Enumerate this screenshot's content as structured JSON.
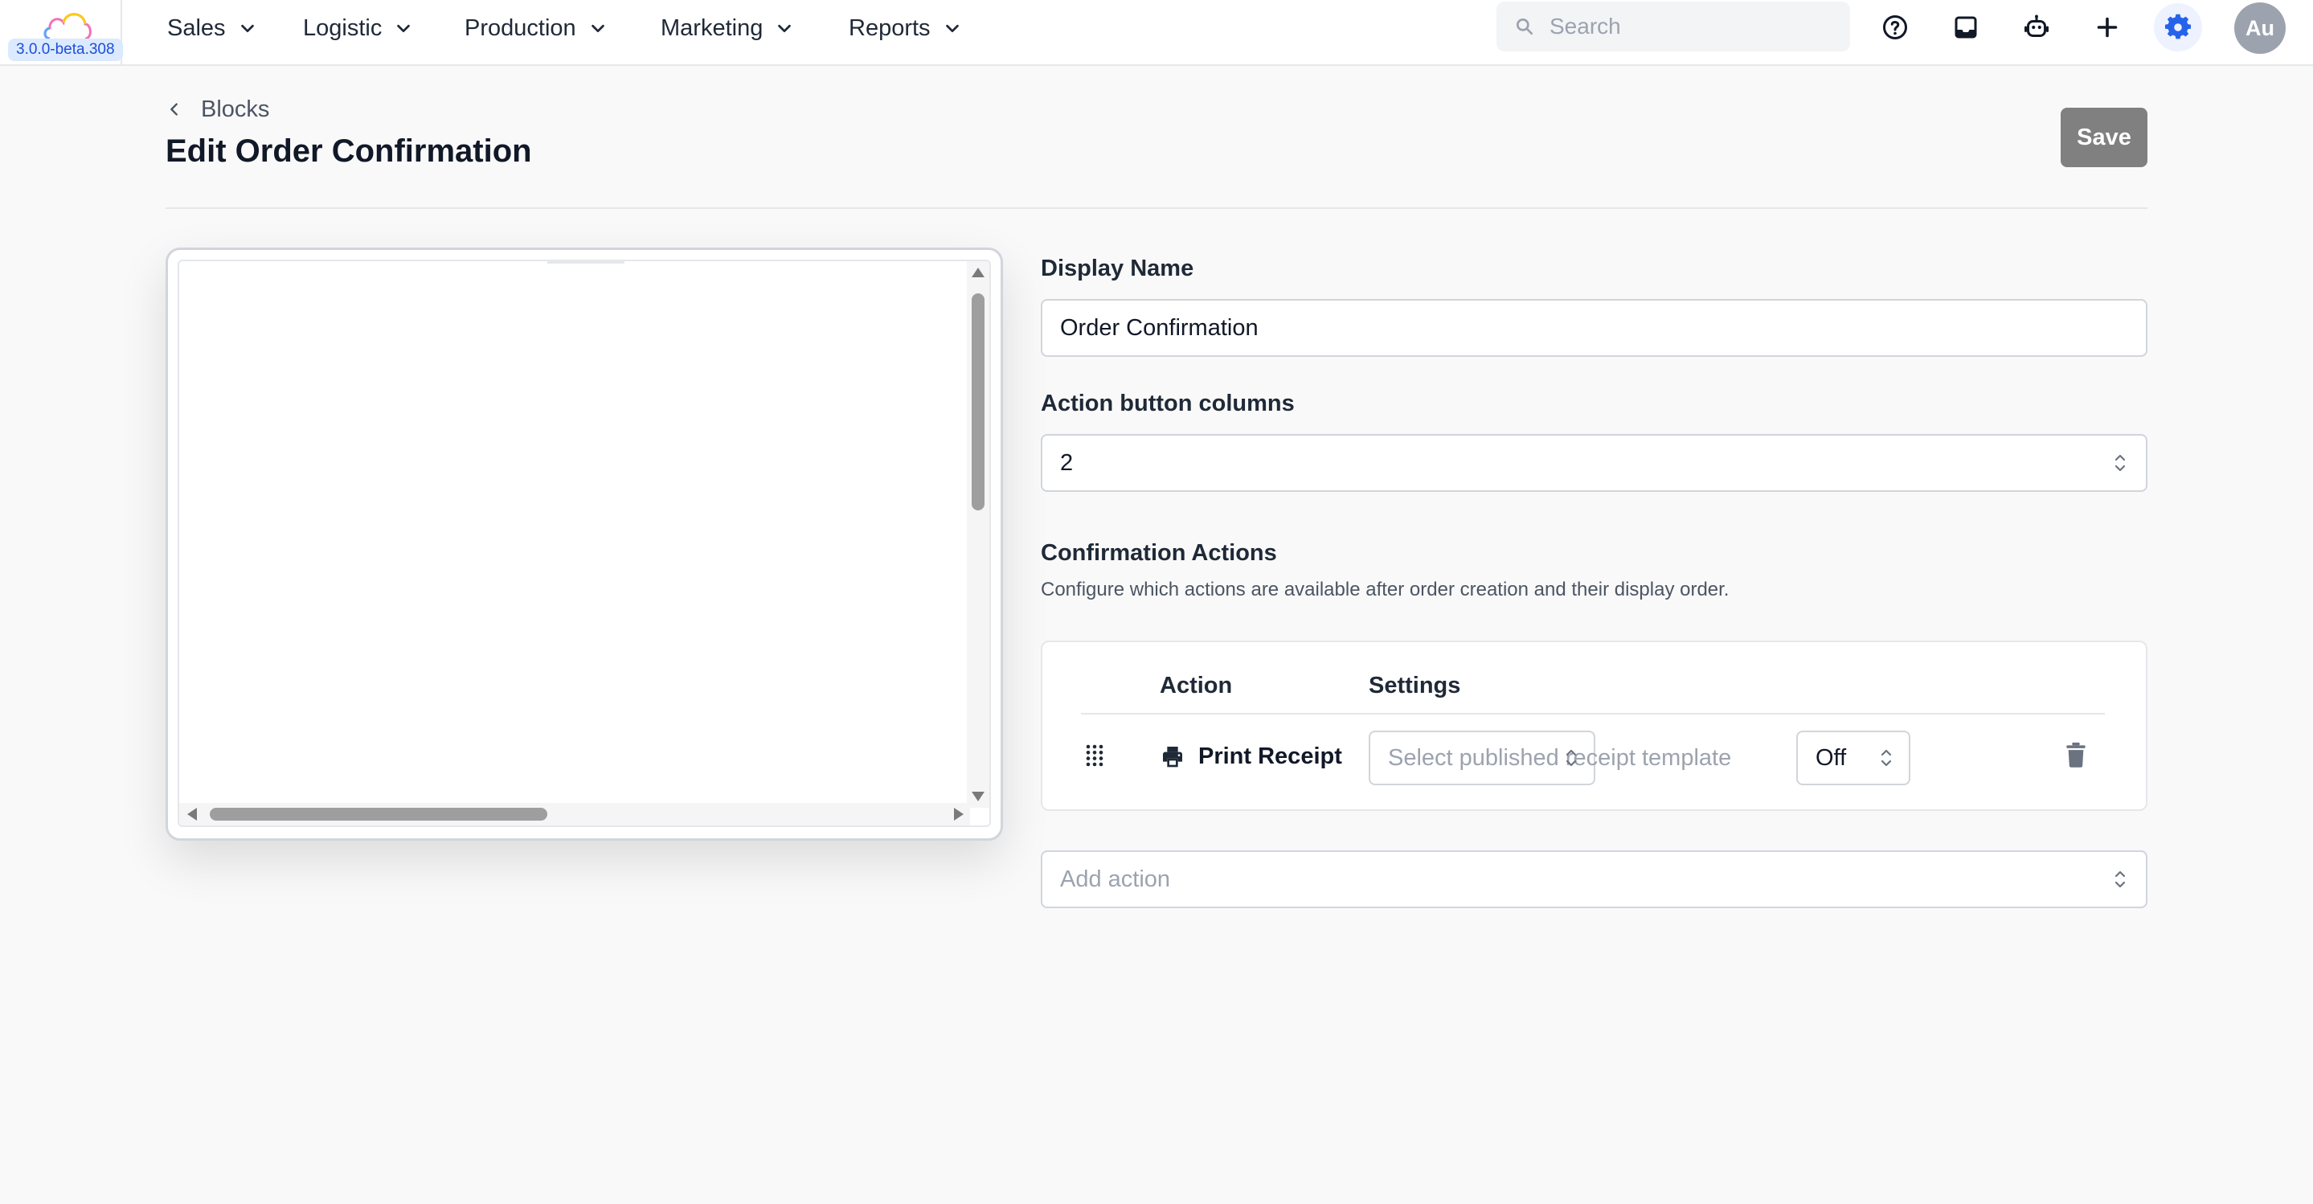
{
  "app": {
    "version": "3.0.0-beta.308",
    "brand_colors": [
      "#60a5fa",
      "#f472b6",
      "#facc15"
    ]
  },
  "nav": {
    "items": [
      {
        "label": "Sales"
      },
      {
        "label": "Logistic"
      },
      {
        "label": "Production"
      },
      {
        "label": "Marketing"
      },
      {
        "label": "Reports"
      }
    ]
  },
  "search": {
    "placeholder": "Search",
    "value": ""
  },
  "toolbar": {
    "icons": [
      "help-circle-icon",
      "inbox-icon",
      "robot-icon",
      "plus-icon",
      "gear-icon"
    ],
    "active_icon_color": "#2563eb"
  },
  "user": {
    "initials": "Au"
  },
  "page": {
    "breadcrumb": "Blocks",
    "title": "Edit Order Confirmation",
    "save_label": "Save"
  },
  "form": {
    "display_name": {
      "label": "Display Name",
      "value": "Order Confirmation"
    },
    "action_button_columns": {
      "label": "Action button columns",
      "value": "2"
    },
    "confirmation_actions": {
      "title": "Confirmation Actions",
      "description": "Configure which actions are available after order creation and their display order.",
      "columns": {
        "action": "Action",
        "settings": "Settings"
      },
      "rows": [
        {
          "icon": "printer-icon",
          "label": "Print Receipt",
          "template_placeholder": "Select published receipt template",
          "toggle_value": "Off"
        }
      ]
    },
    "add_action": {
      "placeholder": "Add action"
    }
  }
}
